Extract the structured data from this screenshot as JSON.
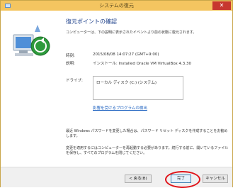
{
  "window": {
    "title": "システムの復元",
    "close_glyph": "✕",
    "titlebar_color": "#f4c560",
    "close_color": "#c7372f"
  },
  "main": {
    "heading": "復元ポイントの確認",
    "intro": "コンピューターは、下の説明に表示されたイベントより前の状態に復元されます。",
    "time_label": "時刻:",
    "time_value": "2015/08/08 14:07:27 (GMT+9:00)",
    "desc_label": "説明:",
    "desc_value": "インストール: Installed Oracle VM VirtualBox 4.3.30",
    "drive_label": "ドライブ:",
    "drive_value": "ローカル ディスク (C:) (システム)",
    "scan_link": "影響を受けるプログラムの検出",
    "password_note": "最近 Windows パスワードを変更した場合は、パスワード リセット ディスクを作成することをお勧めします。",
    "restart_note": "変更を適用するにはコンピューターを再起動する必要があります。続行する前に、開いているファイルを保存し、すべてのプログラムを閉じてください。"
  },
  "footer": {
    "back_label": "< 戻る(B)",
    "finish_label": "完了",
    "cancel_label": "キャンセル"
  },
  "icons": {
    "system": "system-restore-icon",
    "hero": "computer-restore-illustration"
  },
  "accent": {
    "heading": "#1c3f8a",
    "link": "#1a5fbf",
    "highlight": "#e0141a"
  }
}
